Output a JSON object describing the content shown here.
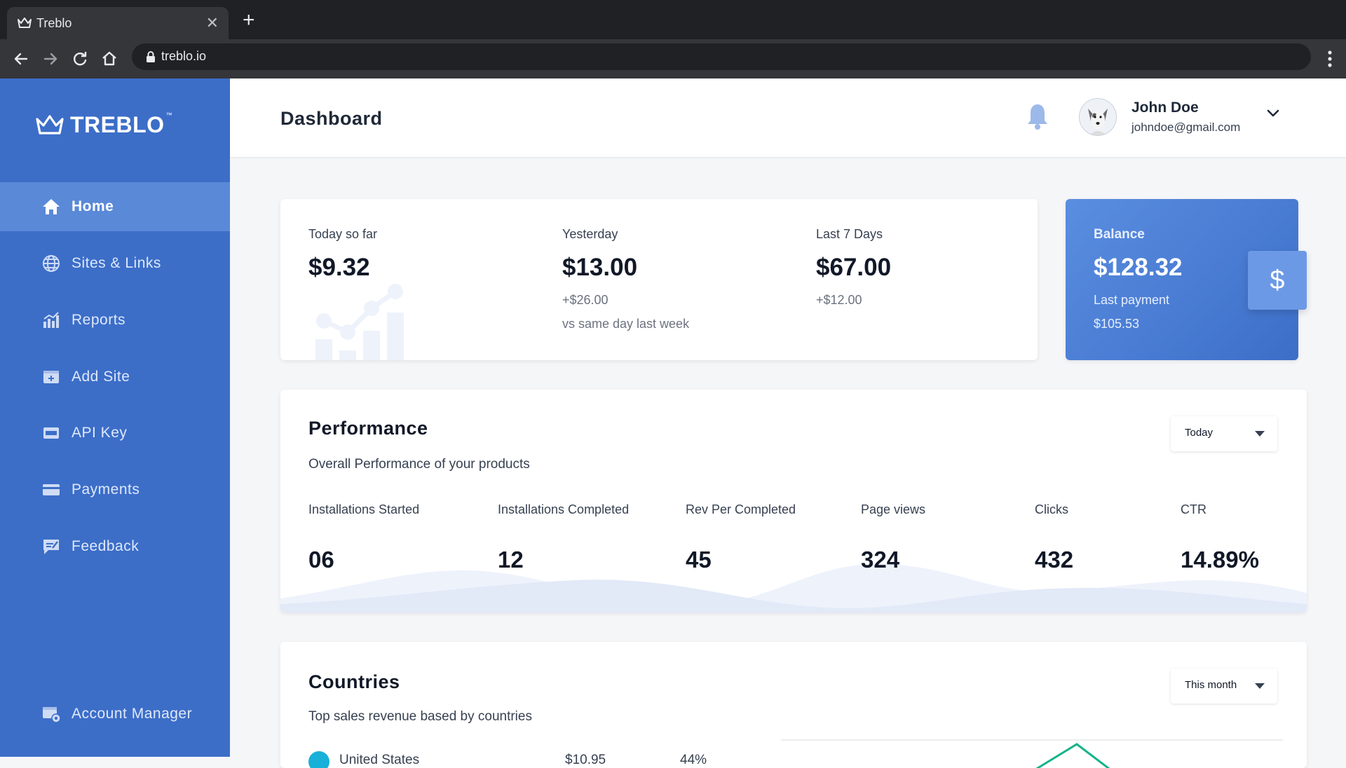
{
  "browser": {
    "tab_title": "Treblo",
    "url": "treblo.io"
  },
  "brand": {
    "name": "TREBLO",
    "tm": "™"
  },
  "sidebar": {
    "items": [
      {
        "label": "Home",
        "icon": "home-icon"
      },
      {
        "label": "Sites & Links",
        "icon": "globe-icon"
      },
      {
        "label": "Reports",
        "icon": "chart-icon"
      },
      {
        "label": "Add Site",
        "icon": "add-site-icon"
      },
      {
        "label": "API Key",
        "icon": "api-key-icon"
      },
      {
        "label": "Payments",
        "icon": "card-icon"
      },
      {
        "label": "Feedback",
        "icon": "feedback-icon"
      }
    ],
    "footer_item": {
      "label": "Account Manager",
      "icon": "account-manager-icon"
    }
  },
  "header": {
    "title": "Dashboard",
    "user_name": "John Doe",
    "user_email": "johndoe@gmail.com"
  },
  "stats": {
    "today_label": "Today so far",
    "today_value": "$9.32",
    "yesterday_label": "Yesterday",
    "yesterday_value": "$13.00",
    "yesterday_change": "+$26.00",
    "yesterday_note": "vs same day last week",
    "week_label": "Last 7 Days",
    "week_value": "$67.00",
    "week_change": "+$12.00"
  },
  "balance": {
    "label": "Balance",
    "value": "$128.32",
    "last_payment_label": "Last payment",
    "last_payment_value": "$105.53",
    "currency_symbol": "$"
  },
  "performance": {
    "title": "Performance",
    "subtitle": "Overall Performance of your products",
    "range": "Today",
    "metrics": [
      {
        "label": "Installations Started",
        "value": "06"
      },
      {
        "label": "Installations Completed",
        "value": "12"
      },
      {
        "label": "Rev Per Completed",
        "value": "45"
      },
      {
        "label": "Page views",
        "value": "324"
      },
      {
        "label": "Clicks",
        "value": "432"
      },
      {
        "label": "CTR",
        "value": "14.89%"
      }
    ]
  },
  "countries": {
    "title": "Countries",
    "subtitle": "Top sales revenue based by countries",
    "range": "This month",
    "rows": [
      {
        "name": "United States",
        "revenue": "$10.95",
        "percent": "44%"
      }
    ]
  },
  "colors": {
    "sidebar": "#3c6ec8",
    "sidebar_active": "#5a89d8",
    "accent": "#4a7fd6",
    "country_dot": "#17b0d8",
    "chart_line": "#16b38a"
  }
}
